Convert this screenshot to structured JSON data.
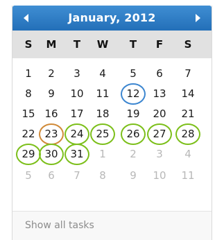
{
  "calendar": {
    "month_title": "January, 2012",
    "prev_icon": "triangle-left-icon",
    "next_icon": "triangle-right-icon",
    "weekday_headers": [
      "S",
      "M",
      "T",
      "W",
      "T",
      "F",
      "S"
    ],
    "weeks": [
      [
        {
          "day": "1",
          "month": "current",
          "mark": null
        },
        {
          "day": "2",
          "month": "current",
          "mark": null
        },
        {
          "day": "3",
          "month": "current",
          "mark": null
        },
        {
          "day": "4",
          "month": "current",
          "mark": null
        },
        {
          "day": "5",
          "month": "current",
          "mark": null
        },
        {
          "day": "6",
          "month": "current",
          "mark": null
        },
        {
          "day": "7",
          "month": "current",
          "mark": null
        }
      ],
      [
        {
          "day": "8",
          "month": "current",
          "mark": null
        },
        {
          "day": "9",
          "month": "current",
          "mark": null
        },
        {
          "day": "10",
          "month": "current",
          "mark": null
        },
        {
          "day": "11",
          "month": "current",
          "mark": null
        },
        {
          "day": "12",
          "month": "current",
          "mark": "today"
        },
        {
          "day": "13",
          "month": "current",
          "mark": null
        },
        {
          "day": "14",
          "month": "current",
          "mark": null
        }
      ],
      [
        {
          "day": "15",
          "month": "current",
          "mark": null
        },
        {
          "day": "16",
          "month": "current",
          "mark": null
        },
        {
          "day": "17",
          "month": "current",
          "mark": null
        },
        {
          "day": "18",
          "month": "current",
          "mark": null
        },
        {
          "day": "19",
          "month": "current",
          "mark": null
        },
        {
          "day": "20",
          "month": "current",
          "mark": null
        },
        {
          "day": "21",
          "month": "current",
          "mark": null
        }
      ],
      [
        {
          "day": "22",
          "month": "current",
          "mark": null
        },
        {
          "day": "23",
          "month": "current",
          "mark": "orange"
        },
        {
          "day": "24",
          "month": "current",
          "mark": "green"
        },
        {
          "day": "25",
          "month": "current",
          "mark": "green"
        },
        {
          "day": "26",
          "month": "current",
          "mark": "green"
        },
        {
          "day": "27",
          "month": "current",
          "mark": "green"
        },
        {
          "day": "28",
          "month": "current",
          "mark": "green"
        }
      ],
      [
        {
          "day": "29",
          "month": "current",
          "mark": "green"
        },
        {
          "day": "30",
          "month": "current",
          "mark": "green"
        },
        {
          "day": "31",
          "month": "current",
          "mark": "green"
        },
        {
          "day": "1",
          "month": "next",
          "mark": null
        },
        {
          "day": "2",
          "month": "next",
          "mark": null
        },
        {
          "day": "3",
          "month": "next",
          "mark": null
        },
        {
          "day": "4",
          "month": "next",
          "mark": null
        }
      ],
      [
        {
          "day": "5",
          "month": "next",
          "mark": null
        },
        {
          "day": "6",
          "month": "next",
          "mark": null
        },
        {
          "day": "7",
          "month": "next",
          "mark": null
        },
        {
          "day": "8",
          "month": "next",
          "mark": null
        },
        {
          "day": "9",
          "month": "next",
          "mark": null
        },
        {
          "day": "10",
          "month": "next",
          "mark": null
        },
        {
          "day": "11",
          "month": "next",
          "mark": null
        }
      ]
    ],
    "footer_link": "Show all tasks"
  },
  "colors": {
    "header": "#2a7bc8",
    "today_ring": "#3c86d0",
    "orange_ring": "#d08a38",
    "green_ring": "#7cbf1a",
    "weekday_bar": "#e1e1e1",
    "other_month_text": "#b8b8b8"
  }
}
